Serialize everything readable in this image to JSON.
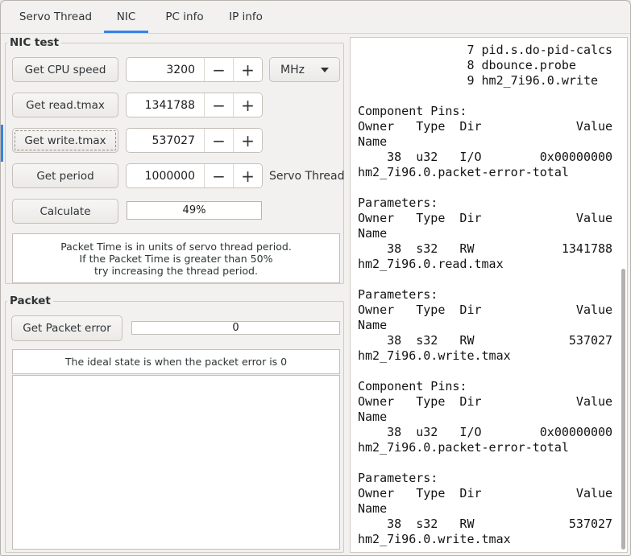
{
  "colors": {
    "accent": "#3584e4",
    "window_bg": "#f3f1ef",
    "border": "#cfcac4"
  },
  "icons": {
    "minus": "−",
    "plus": "+",
    "caret": "chevron-down"
  },
  "tabs": [
    {
      "label": "Servo Thread",
      "active": false
    },
    {
      "label": "NIC",
      "active": true
    },
    {
      "label": "PC info",
      "active": false
    },
    {
      "label": "IP info",
      "active": false
    }
  ],
  "nic_test": {
    "title": "NIC test",
    "cpu": {
      "button": "Get CPU speed",
      "value": "3200",
      "unit": "MHz"
    },
    "read": {
      "button": "Get read.tmax",
      "value": "1341788"
    },
    "write": {
      "button": "Get write.tmax",
      "value": "537027"
    },
    "period": {
      "button": "Get period",
      "value": "1000000",
      "label": "Servo Thread"
    },
    "calculate": {
      "button": "Calculate",
      "progress": "49%"
    },
    "note": [
      "Packet Time is in units of servo thread period.",
      "If the Packet Time is greater than 50%",
      "try increasing the thread period."
    ]
  },
  "packet": {
    "title": "Packet",
    "button": "Get Packet error",
    "value": "0",
    "note": "The ideal state is when the packet error is 0"
  },
  "hal_output": {
    "lines": [
      "               7 pid.s.do-pid-calcs",
      "               8 dbounce.probe",
      "               9 hm2_7i96.0.write",
      "",
      "Component Pins:",
      "Owner   Type  Dir             Value",
      "Name",
      "    38  u32   I/O        0x00000000",
      "hm2_7i96.0.packet-error-total",
      "",
      "Parameters:",
      "Owner   Type  Dir             Value",
      "Name",
      "    38  s32   RW            1341788",
      "hm2_7i96.0.read.tmax",
      "",
      "Parameters:",
      "Owner   Type  Dir             Value",
      "Name",
      "    38  s32   RW             537027",
      "hm2_7i96.0.write.tmax",
      "",
      "Component Pins:",
      "Owner   Type  Dir             Value",
      "Name",
      "    38  u32   I/O        0x00000000",
      "hm2_7i96.0.packet-error-total",
      "",
      "Parameters:",
      "Owner   Type  Dir             Value",
      "Name",
      "    38  s32   RW             537027",
      "hm2_7i96.0.write.tmax"
    ]
  }
}
